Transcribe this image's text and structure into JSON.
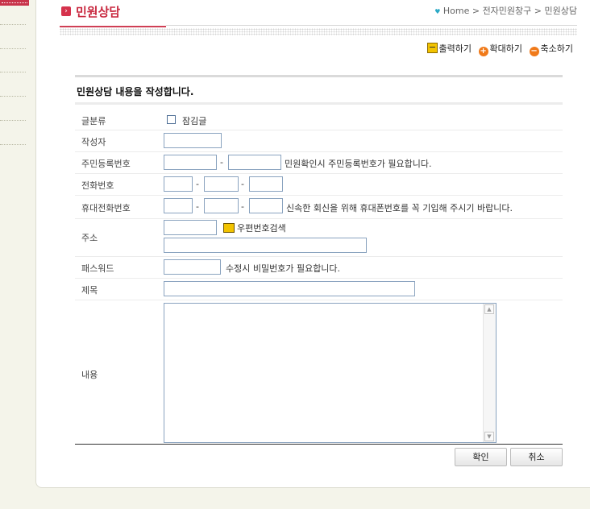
{
  "header": {
    "title": "민원상담",
    "breadcrumb": {
      "home": "Home",
      "sep1": ">",
      "level1": "전자민원창구",
      "sep2": ">",
      "level2": "민원상담"
    }
  },
  "toolbar": {
    "print": "출력하기",
    "zoom_in": "확대하기",
    "zoom_out": "축소하기"
  },
  "form": {
    "heading": "민원상담 내용을 작성합니다.",
    "rows": {
      "category": {
        "label": "글분류",
        "option": "잠김글"
      },
      "writer": {
        "label": "작성자"
      },
      "rrn": {
        "label": "주민등록번호",
        "dash": "-",
        "note": "민원확인시 주민등록번호가 필요합니다."
      },
      "phone": {
        "label": "전화번호",
        "dash": "-"
      },
      "mobile": {
        "label": "휴대전화번호",
        "dash": "-",
        "note": "신속한 회신을 위해 휴대폰번호를 꼭 기입해 주시기 바랍니다."
      },
      "address": {
        "label": "주소",
        "zip_search": "우편번호검색"
      },
      "password": {
        "label": "패스워드",
        "note": "수정시 비밀번호가 필요합니다."
      },
      "subject": {
        "label": "제목"
      },
      "content": {
        "label": "내용"
      }
    },
    "buttons": {
      "confirm": "확인",
      "cancel": "취소"
    }
  },
  "colors": {
    "accent": "#c8283f",
    "side_bg": "#f4f4ea",
    "input_border": "#8aa3bf"
  }
}
